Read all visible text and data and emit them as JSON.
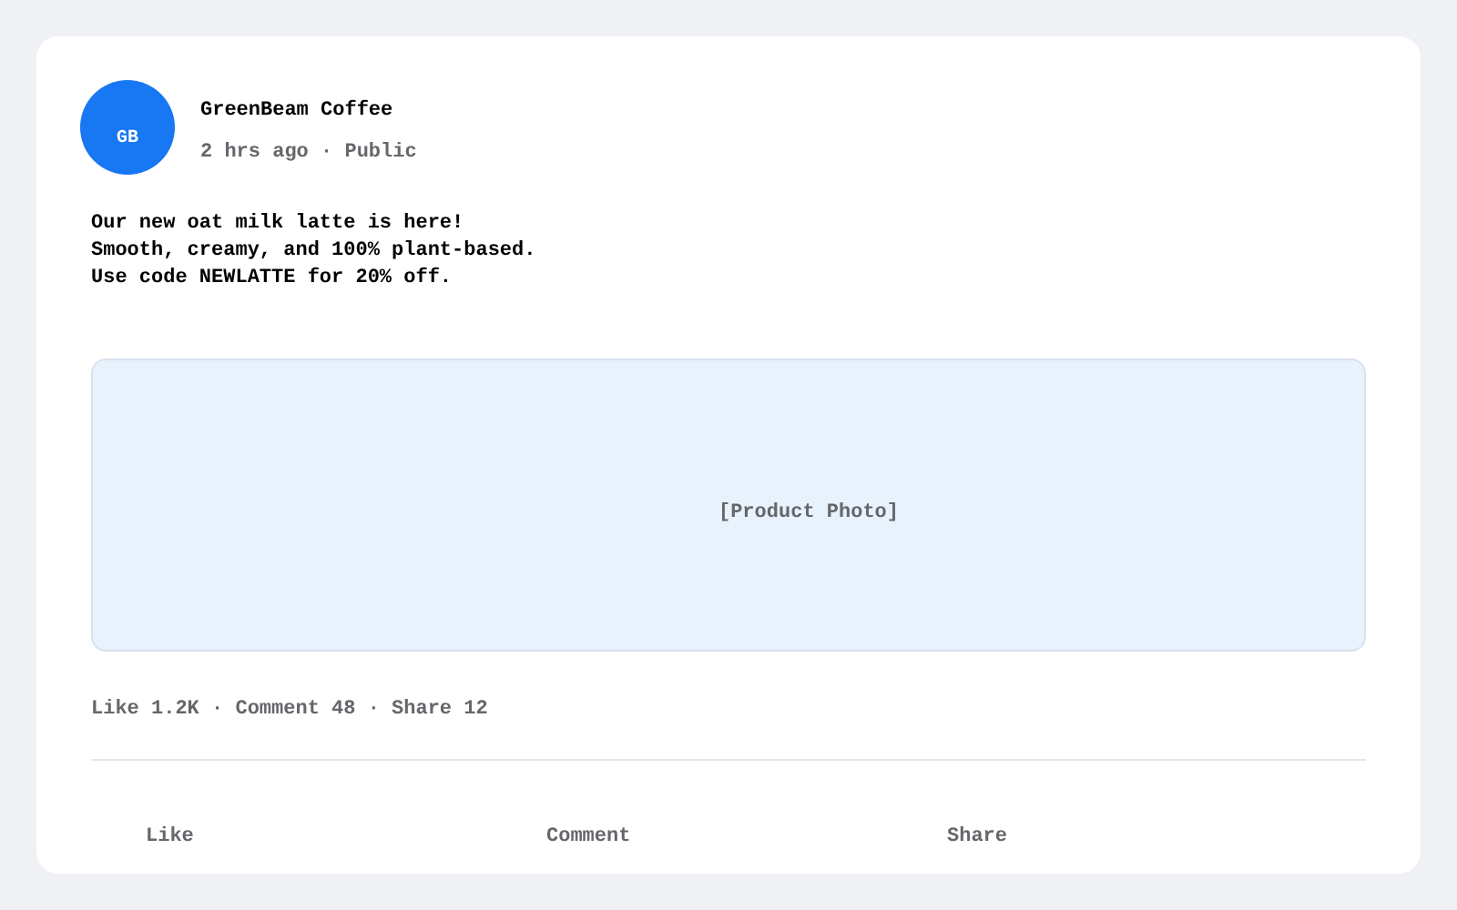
{
  "post": {
    "author": "GreenBeam Coffee",
    "avatar_initials": "GB",
    "meta": "2 hrs ago · Public",
    "text_lines": [
      "Our new oat milk latte is here!",
      "Smooth, creamy, and 100% plant-based.",
      "Use code NEWLATTE for 20% off."
    ],
    "media_placeholder": "[Product Photo]",
    "stats": "Like 1.2K · Comment 48 · Share 12",
    "actions": [
      "Like",
      "Comment",
      "Share"
    ]
  }
}
